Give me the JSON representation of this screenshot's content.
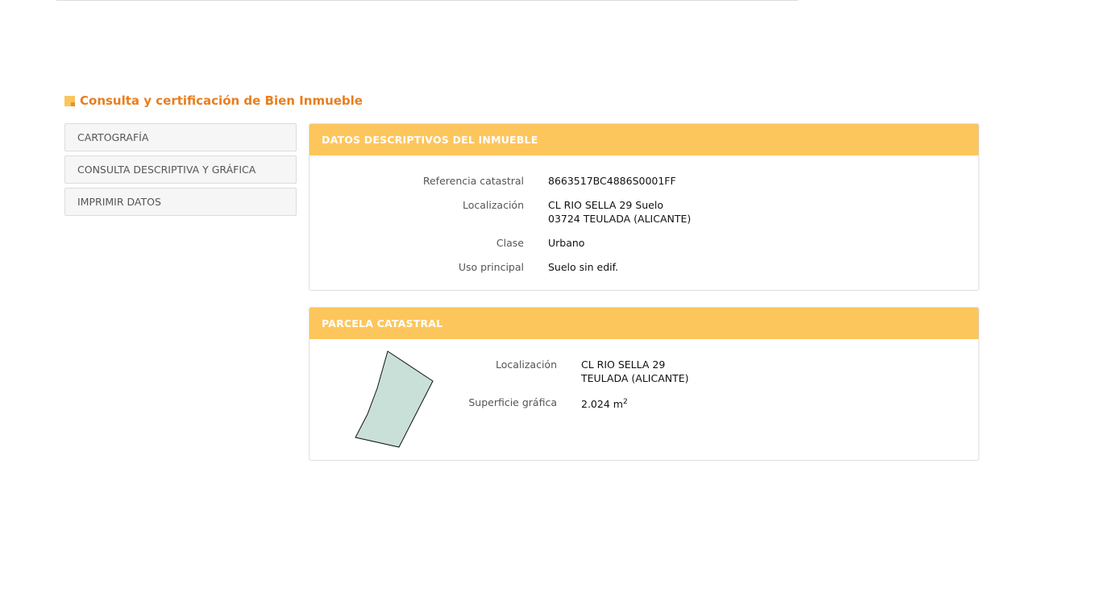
{
  "header": {
    "title": "Consulta y certificación de Bien Inmueble"
  },
  "sidebar": {
    "items": [
      {
        "label": "CARTOGRAFÍA"
      },
      {
        "label": "CONSULTA DESCRIPTIVA Y GRÁFICA"
      },
      {
        "label": "IMPRIMIR DATOS"
      }
    ]
  },
  "inmueble": {
    "heading": "DATOS DESCRIPTIVOS DEL INMUEBLE",
    "referencia_label": "Referencia catastral",
    "referencia_value": "8663517BC4886S0001FF",
    "localizacion_label": "Localización",
    "localizacion_line1": "CL RIO SELLA 29 Suelo",
    "localizacion_line2": "03724 TEULADA (ALICANTE)",
    "clase_label": "Clase",
    "clase_value": "Urbano",
    "uso_label": "Uso principal",
    "uso_value": "Suelo sin edif."
  },
  "parcela": {
    "heading": "PARCELA CATASTRAL",
    "localizacion_label": "Localización",
    "localizacion_line1": "CL RIO SELLA 29",
    "localizacion_line2": "TEULADA (ALICANTE)",
    "superficie_label": "Superficie gráfica",
    "superficie_value": "2.024 m",
    "superficie_unit_sup": "2",
    "shape_fill": "#c9e0d8"
  },
  "colors": {
    "accent": "#fcc65d",
    "title": "#e87e1f"
  }
}
